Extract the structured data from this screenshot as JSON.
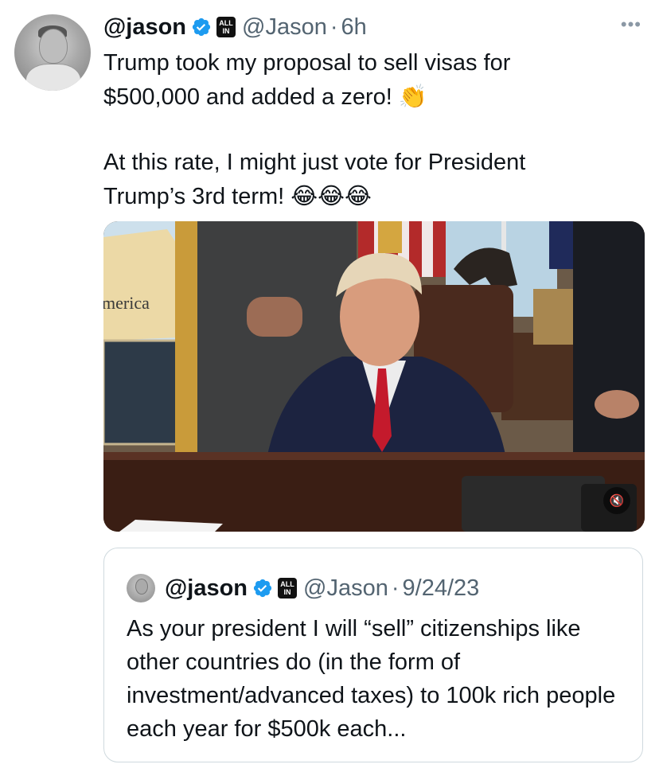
{
  "tweet": {
    "display_name": "@jason",
    "handle": "@Jason",
    "separator": "·",
    "time": "6h",
    "more_label": "•••",
    "text_line1": "Trump took my proposal to sell visas for",
    "text_line2": "$500,000 and added a zero!",
    "emoji_clap": "👏",
    "text_line3": "At this rate, I might just vote for President",
    "text_line4": "Trump’s 3rd term!",
    "emoji_laugh": "😂😂😂",
    "map_label": "merica",
    "mute_label": "🔇"
  },
  "badges": {
    "verified_color": "#1d9bf0",
    "allin_top": "ALL",
    "allin_bottom": "IN"
  },
  "quote": {
    "display_name": "@jason",
    "handle": "@Jason",
    "separator": "·",
    "date": "9/24/23",
    "text": "As your president I will “sell” citizenships like other countries do (in the form of investment/advanced taxes) to 100k rich people each year for $500k each..."
  },
  "icons": [
    "verified-badge-icon",
    "all-in-badge-icon",
    "more-options-icon",
    "mute-icon"
  ]
}
